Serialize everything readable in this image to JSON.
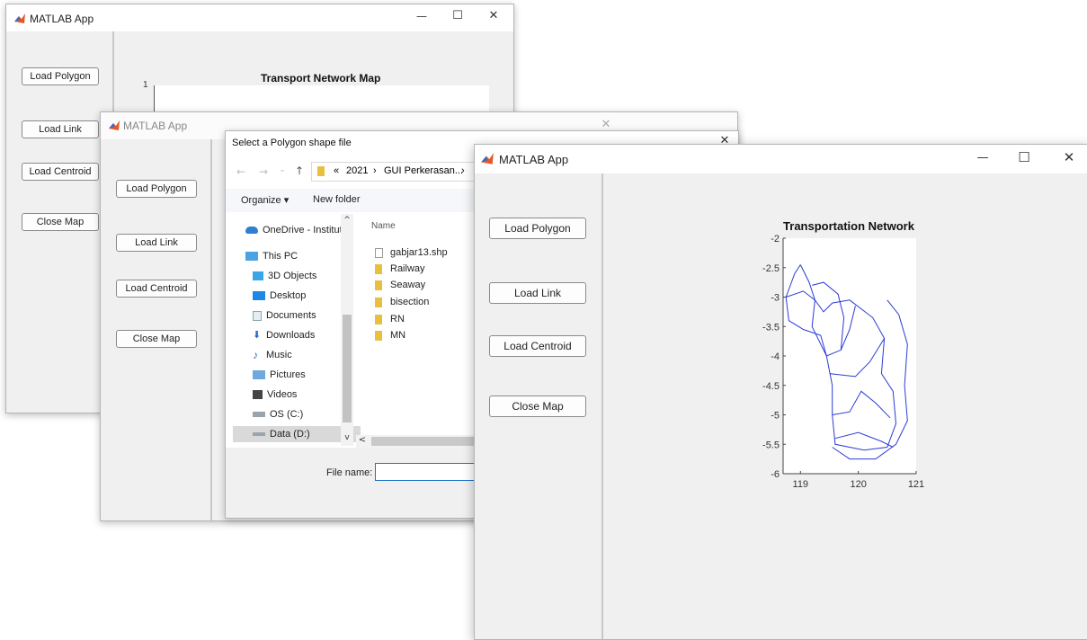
{
  "window_back": {
    "title": "MATLAB App",
    "buttons": [
      "Load Polygon",
      "Load Link",
      "Load Centroid",
      "Close Map"
    ],
    "plot_title": "Transport Network Map",
    "axis_top_label": "1"
  },
  "window_mid": {
    "title": "MATLAB App",
    "buttons": [
      "Load Polygon",
      "Load Link",
      "Load Centroid",
      "Close Map"
    ]
  },
  "file_dialog": {
    "title": "Select a Polygon shape file",
    "breadcrumb": [
      "«",
      "2021",
      "›",
      "GUI Perkerasan...",
      "›"
    ],
    "toolbar": {
      "organize": "Organize ▾",
      "new_folder": "New folder"
    },
    "nav_items": [
      {
        "label": "OneDrive - Institut",
        "icon": "cloud-icon"
      },
      {
        "label": "This PC",
        "icon": "computer-icon"
      },
      {
        "label": "3D Objects",
        "icon": "cube-icon"
      },
      {
        "label": "Desktop",
        "icon": "desktop-icon"
      },
      {
        "label": "Documents",
        "icon": "document-icon"
      },
      {
        "label": "Downloads",
        "icon": "download-icon"
      },
      {
        "label": "Music",
        "icon": "music-icon"
      },
      {
        "label": "Pictures",
        "icon": "picture-icon"
      },
      {
        "label": "Videos",
        "icon": "video-icon"
      },
      {
        "label": "OS (C:)",
        "icon": "drive-icon"
      },
      {
        "label": "Data (D:)",
        "icon": "drive-icon"
      }
    ],
    "column_header": "Name",
    "files": [
      {
        "name": "gabjar13.shp",
        "kind": "file"
      },
      {
        "name": "Railway",
        "kind": "folder"
      },
      {
        "name": "Seaway",
        "kind": "folder"
      },
      {
        "name": "bisection",
        "kind": "folder"
      },
      {
        "name": "RN",
        "kind": "folder"
      },
      {
        "name": "MN",
        "kind": "folder"
      }
    ],
    "filename_label": "File name:",
    "filename_value": "",
    "close_symbol": "✕"
  },
  "window_front": {
    "title": "MATLAB App",
    "buttons": [
      "Load Polygon",
      "Load Link",
      "Load Centroid",
      "Close Map"
    ],
    "window_controls": {
      "minimize": "—",
      "maximize": "☐",
      "close": "✕"
    }
  },
  "chart_data": {
    "type": "line",
    "title": "Transportation Network",
    "xlabel": "",
    "ylabel": "",
    "xlim": [
      118.7,
      121
    ],
    "ylim": [
      -6,
      -2
    ],
    "xticks": [
      119,
      120,
      121
    ],
    "xtick_labels": [
      "119",
      "120",
      "121"
    ],
    "yticks": [
      -2,
      -2.5,
      -3,
      -3.5,
      -4,
      -4.5,
      -5,
      -5.5,
      -6
    ],
    "ytick_labels": [
      "-2",
      "-2.5",
      "-3",
      "-3.5",
      "-4",
      "-4.5",
      "-5",
      "-5.5",
      "-6"
    ],
    "grid": false,
    "series": [
      {
        "values": [
          [
            119.0,
            -2.45
          ],
          [
            118.9,
            -2.6
          ],
          [
            118.75,
            -3.0
          ],
          [
            118.8,
            -3.4
          ],
          [
            119.05,
            -3.55
          ],
          [
            119.35,
            -3.65
          ],
          [
            119.45,
            -4.0
          ],
          [
            119.55,
            -4.5
          ],
          [
            119.55,
            -5.0
          ],
          [
            119.6,
            -5.5
          ],
          [
            120.1,
            -5.6
          ],
          [
            120.5,
            -5.55
          ],
          [
            120.65,
            -5.15
          ],
          [
            120.6,
            -4.6
          ],
          [
            120.4,
            -4.3
          ],
          [
            120.45,
            -3.7
          ],
          [
            120.25,
            -3.35
          ],
          [
            119.85,
            -3.05
          ],
          [
            119.55,
            -3.1
          ],
          [
            119.4,
            -3.25
          ],
          [
            119.25,
            -3.05
          ],
          [
            119.15,
            -2.75
          ],
          [
            119.0,
            -2.45
          ]
        ]
      },
      {
        "values": [
          [
            118.75,
            -3.0
          ],
          [
            119.05,
            -2.9
          ],
          [
            119.25,
            -3.05
          ],
          [
            119.2,
            -3.5
          ],
          [
            119.45,
            -4.0
          ],
          [
            119.7,
            -3.9
          ],
          [
            119.85,
            -3.55
          ],
          [
            119.95,
            -3.15
          ]
        ]
      },
      {
        "values": [
          [
            119.5,
            -4.3
          ],
          [
            119.95,
            -4.35
          ],
          [
            120.2,
            -4.1
          ],
          [
            120.45,
            -3.7
          ]
        ]
      },
      {
        "values": [
          [
            119.55,
            -5.0
          ],
          [
            119.85,
            -4.95
          ],
          [
            120.05,
            -4.6
          ],
          [
            120.3,
            -4.8
          ],
          [
            120.55,
            -5.05
          ]
        ]
      },
      {
        "values": [
          [
            119.6,
            -5.4
          ],
          [
            120.0,
            -5.3
          ],
          [
            120.4,
            -5.45
          ],
          [
            120.6,
            -5.55
          ]
        ]
      },
      {
        "values": [
          [
            120.5,
            -3.05
          ],
          [
            120.7,
            -3.3
          ],
          [
            120.85,
            -3.8
          ],
          [
            120.8,
            -4.5
          ],
          [
            120.85,
            -5.1
          ],
          [
            120.65,
            -5.5
          ],
          [
            120.3,
            -5.75
          ],
          [
            119.85,
            -5.75
          ],
          [
            119.55,
            -5.55
          ]
        ]
      },
      {
        "values": [
          [
            119.2,
            -2.8
          ],
          [
            119.4,
            -2.75
          ],
          [
            119.65,
            -2.95
          ],
          [
            119.75,
            -3.35
          ],
          [
            119.7,
            -3.9
          ]
        ]
      }
    ],
    "line_color": "#2b3bd6"
  }
}
